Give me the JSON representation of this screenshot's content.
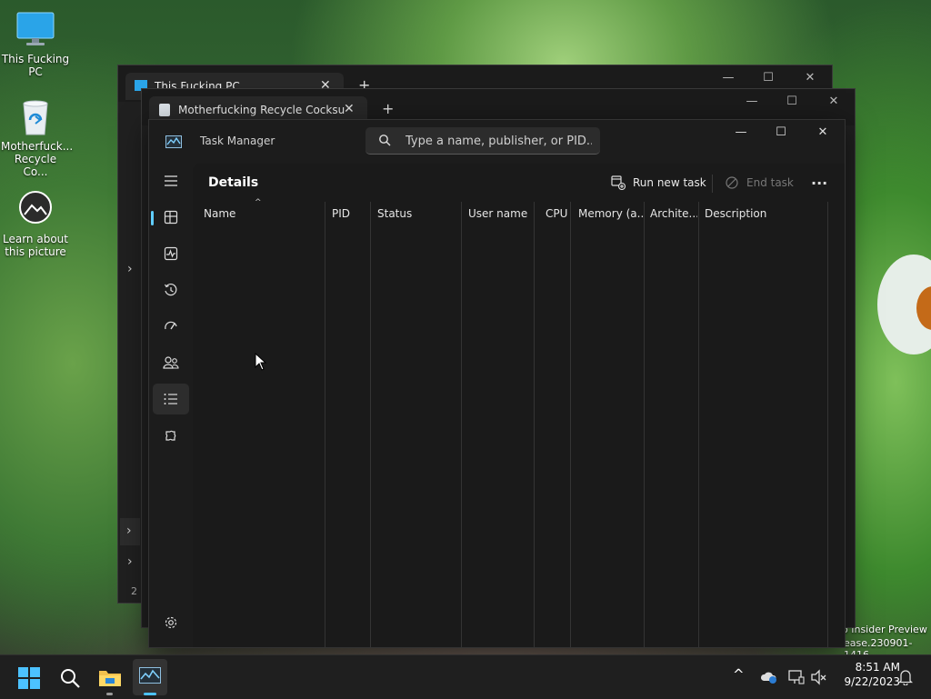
{
  "desktop": {
    "icons": [
      {
        "label": "This Fucking PC",
        "icon": "monitor-icon"
      },
      {
        "label": "Motherfuck... Recycle Co...",
        "icon": "recycle-bin-icon"
      },
      {
        "label": "Learn about this picture",
        "icon": "learn-picture-icon"
      }
    ],
    "watermark_line1": "o Insider Preview",
    "watermark_line2": "ease.230901-1416"
  },
  "back_window_1": {
    "tab_title": "This Fucking PC"
  },
  "back_window_2": {
    "tab_title": "Motherfucking Recycle Cocksu"
  },
  "task_manager": {
    "title": "Task Manager",
    "search_placeholder": "Type a name, publisher, or PID...",
    "page_title": "Details",
    "run_new_task": "Run new task",
    "end_task": "End task",
    "more": "···",
    "columns": [
      "Name",
      "PID",
      "Status",
      "User name",
      "CPU",
      "Memory (a...",
      "Archite...",
      "Description"
    ],
    "nav_items": [
      "processes-icon",
      "performance-icon",
      "app-history-icon",
      "startup-apps-icon",
      "users-icon",
      "details-icon",
      "services-icon"
    ]
  },
  "taskbar": {
    "time": "8:51 AM",
    "date": "9/22/2023",
    "overflow_chevron": "^"
  },
  "colors": {
    "accent": "#60cdff",
    "window_bg": "#1c1c1c",
    "taskbar_bg": "#1f1f1f"
  }
}
